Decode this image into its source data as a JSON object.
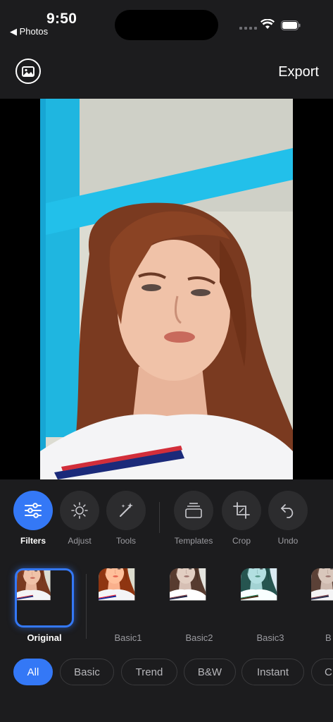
{
  "status_bar": {
    "time": "9:50",
    "back_app": "◀ Photos"
  },
  "header": {
    "export_label": "Export",
    "gallery_icon": "image-icon"
  },
  "toolbar": {
    "tools": [
      {
        "label": "Filters",
        "icon": "sliders-icon",
        "active": true
      },
      {
        "label": "Adjust",
        "icon": "sun-icon",
        "active": false
      },
      {
        "label": "Tools",
        "icon": "magic-wand-icon",
        "active": false
      },
      {
        "label": "Templates",
        "icon": "stack-icon",
        "active": false
      },
      {
        "label": "Crop",
        "icon": "crop-icon",
        "active": false
      },
      {
        "label": "Undo",
        "icon": "undo-icon",
        "active": false
      }
    ]
  },
  "filters": {
    "items": [
      {
        "label": "Original",
        "selected": true
      },
      {
        "label": "Basic1",
        "selected": false
      },
      {
        "label": "Basic2",
        "selected": false
      },
      {
        "label": "Basic3",
        "selected": false
      },
      {
        "label": "B",
        "selected": false
      }
    ]
  },
  "categories": {
    "items": [
      {
        "label": "All",
        "active": true
      },
      {
        "label": "Basic",
        "active": false
      },
      {
        "label": "Trend",
        "active": false
      },
      {
        "label": "B&W",
        "active": false
      },
      {
        "label": "Instant",
        "active": false
      },
      {
        "label": "C",
        "active": false
      }
    ]
  },
  "colors": {
    "accent": "#3478f6",
    "background": "#1c1c1e",
    "tool_bg": "#2c2c2e"
  }
}
